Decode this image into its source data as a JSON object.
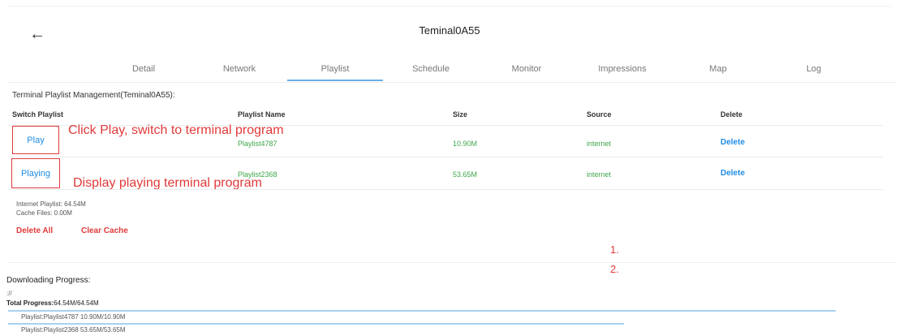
{
  "header": {
    "title": "Teminal0A55",
    "back_icon": "←"
  },
  "tabs": [
    {
      "label": "Detail"
    },
    {
      "label": "Network"
    },
    {
      "label": "Playlist",
      "active": true
    },
    {
      "label": "Schedule"
    },
    {
      "label": "Monitor"
    },
    {
      "label": "Impressions"
    },
    {
      "label": "Map"
    },
    {
      "label": "Log"
    }
  ],
  "section_title": "Terminal Playlist Management(Teminal0A55):",
  "table": {
    "headers": [
      "Switch Playlist",
      "Playlist Name",
      "Size",
      "Source",
      "Delete"
    ],
    "rows": [
      {
        "switch": "Play",
        "name": "Playlist4787",
        "size": "10.90M",
        "source": "internet",
        "delete": "Delete"
      },
      {
        "switch": "Playing",
        "name": "Playlist2368",
        "size": "53.65M",
        "source": "internet",
        "delete": "Delete"
      }
    ]
  },
  "annotations": {
    "play_note": "Click Play, switch to terminal program",
    "playing_note": "Display playing terminal program",
    "num1": "1.",
    "num2": "2."
  },
  "summary": {
    "internet_playlist": "Internet Playlist:  64.54M",
    "cache_files": "Cache Files:  0.00M",
    "delete_all": "Delete All",
    "clear_cache": "Clear Cache"
  },
  "download": {
    "title": "Downloading Progress:",
    "path": "://",
    "total_label": "Total Progress:",
    "total_value": "64.54M/64.54M",
    "items": [
      {
        "label": "Playlist:Playlist4787  10.90M/10.90M",
        "progress": 1.0
      },
      {
        "label": "Playlist:Playlist2368  53.65M/53.65M",
        "progress": 1.0
      }
    ]
  },
  "colors": {
    "accent": "#1f8ce3",
    "annotation": "#e03a3a",
    "green": "#3fa74a",
    "progress": "#a9d1f0"
  }
}
